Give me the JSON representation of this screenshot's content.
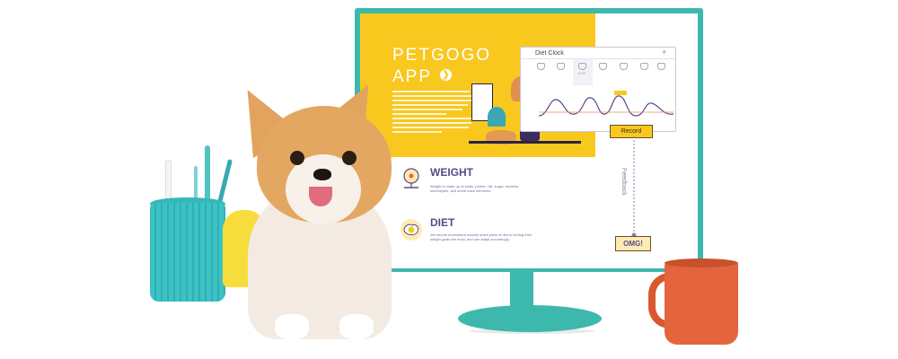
{
  "app": {
    "title_line1": "PETGOGO",
    "title_line2": "APP",
    "go_arrow": "❯"
  },
  "diet_clock": {
    "title": "Diet Clock",
    "close_glyph": "+",
    "times": [
      "",
      "",
      "",
      "12:00",
      "",
      "",
      ""
    ]
  },
  "buttons": {
    "record": "Record",
    "omg": "OMG!"
  },
  "sections": {
    "weight": {
      "title": "WEIGHT",
      "text": "Weight is made up of water, protein, fat, sugar, vitamins, electrolytes, and some trace elements"
    },
    "diet": {
      "title": "DIET",
      "text": "We should understand exactly which parts of diet is hurting their weight goals the most, and can adapt accordingly."
    }
  },
  "feedback_label": "Feedback",
  "colors": {
    "hero_yellow": "#f8c81f",
    "monitor_teal": "#3db8ac",
    "heading_purple": "#5a4a8a",
    "mug_orange": "#e4643e",
    "record_button": "#f8c81f"
  },
  "icons": [
    "go-arrow-icon",
    "weight-scale-icon",
    "diet-egg-icon",
    "meal-icon",
    "close-icon"
  ]
}
